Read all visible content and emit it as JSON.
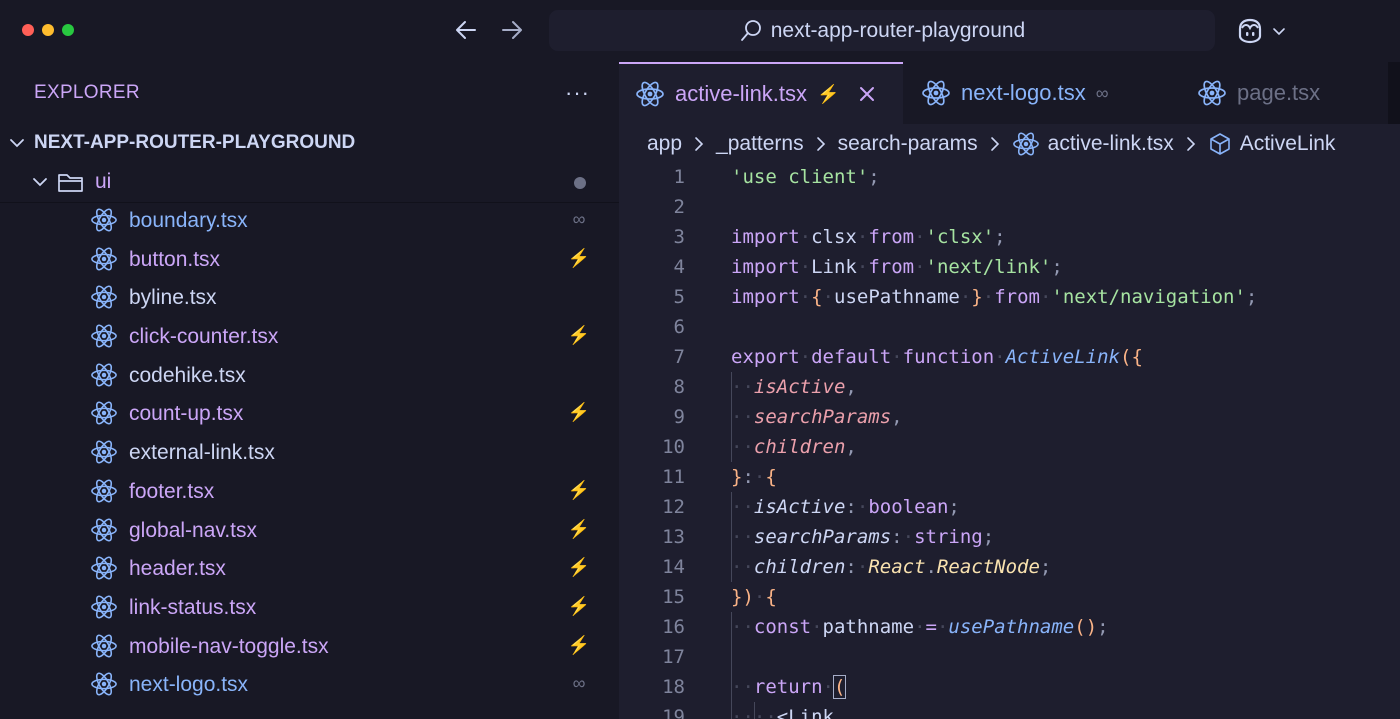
{
  "window": {
    "search_text": "next-app-router-playground"
  },
  "sidebar": {
    "header": "EXPLORER",
    "more": "···",
    "project": "NEXT-APP-ROUTER-PLAYGROUND",
    "folder": "ui",
    "files": [
      {
        "name": "boundary.tsx",
        "badge": "∞",
        "color": "#89b4fa"
      },
      {
        "name": "button.tsx",
        "badge": "⚡",
        "color": "#cba6f7"
      },
      {
        "name": "byline.tsx",
        "badge": "",
        "color": "#cdd6f4"
      },
      {
        "name": "click-counter.tsx",
        "badge": "⚡",
        "color": "#cba6f7"
      },
      {
        "name": "codehike.tsx",
        "badge": "",
        "color": "#cdd6f4"
      },
      {
        "name": "count-up.tsx",
        "badge": "⚡",
        "color": "#cba6f7"
      },
      {
        "name": "external-link.tsx",
        "badge": "",
        "color": "#cdd6f4"
      },
      {
        "name": "footer.tsx",
        "badge": "⚡",
        "color": "#cba6f7"
      },
      {
        "name": "global-nav.tsx",
        "badge": "⚡",
        "color": "#cba6f7"
      },
      {
        "name": "header.tsx",
        "badge": "⚡",
        "color": "#cba6f7"
      },
      {
        "name": "link-status.tsx",
        "badge": "⚡",
        "color": "#cba6f7"
      },
      {
        "name": "mobile-nav-toggle.tsx",
        "badge": "⚡",
        "color": "#cba6f7"
      },
      {
        "name": "next-logo.tsx",
        "badge": "∞",
        "color": "#89b4fa"
      }
    ]
  },
  "tabs": [
    {
      "label": "active-link.tsx",
      "badge": "⚡"
    },
    {
      "label": "next-logo.tsx",
      "badge": "∞"
    },
    {
      "label": "page.tsx",
      "badge": ""
    }
  ],
  "breadcrumb": [
    "app",
    "_patterns",
    "search-params",
    "active-link.tsx",
    "ActiveLink"
  ],
  "code": [
    {
      "n": "1",
      "segs": [
        [
          "'use client'",
          "str"
        ],
        [
          ";",
          "punct"
        ]
      ]
    },
    {
      "n": "2",
      "segs": []
    },
    {
      "n": "3",
      "segs": [
        [
          "import",
          "kw"
        ],
        [
          "·",
          "ws"
        ],
        [
          "clsx",
          "plain"
        ],
        [
          "·",
          "ws"
        ],
        [
          "from",
          "kw"
        ],
        [
          "·",
          "ws"
        ],
        [
          "'clsx'",
          "str"
        ],
        [
          ";",
          "punct"
        ]
      ]
    },
    {
      "n": "4",
      "segs": [
        [
          "import",
          "kw"
        ],
        [
          "·",
          "ws"
        ],
        [
          "Link",
          "plain"
        ],
        [
          "·",
          "ws"
        ],
        [
          "from",
          "kw"
        ],
        [
          "·",
          "ws"
        ],
        [
          "'next/link'",
          "str"
        ],
        [
          ";",
          "punct"
        ]
      ]
    },
    {
      "n": "5",
      "segs": [
        [
          "import",
          "kw"
        ],
        [
          "·",
          "ws"
        ],
        [
          "{",
          "brace"
        ],
        [
          "·",
          "ws"
        ],
        [
          "usePathname",
          "plain"
        ],
        [
          "·",
          "ws"
        ],
        [
          "}",
          "brace"
        ],
        [
          "·",
          "ws"
        ],
        [
          "from",
          "kw"
        ],
        [
          "·",
          "ws"
        ],
        [
          "'next/navigation'",
          "str"
        ],
        [
          ";",
          "punct"
        ]
      ]
    },
    {
      "n": "6",
      "segs": []
    },
    {
      "n": "7",
      "segs": [
        [
          "export",
          "kw"
        ],
        [
          "·",
          "ws"
        ],
        [
          "default",
          "kw"
        ],
        [
          "·",
          "ws"
        ],
        [
          "function",
          "kw"
        ],
        [
          "·",
          "ws"
        ],
        [
          "ActiveLink",
          "fn"
        ],
        [
          "(",
          "brace"
        ],
        [
          "{",
          "brace"
        ]
      ]
    },
    {
      "n": "8",
      "guide": 1,
      "segs": [
        [
          "··",
          "ws"
        ],
        [
          "isActive",
          "param"
        ],
        [
          ",",
          "punct"
        ]
      ]
    },
    {
      "n": "9",
      "guide": 1,
      "segs": [
        [
          "··",
          "ws"
        ],
        [
          "searchParams",
          "param"
        ],
        [
          ",",
          "punct"
        ]
      ]
    },
    {
      "n": "10",
      "guide": 1,
      "segs": [
        [
          "··",
          "ws"
        ],
        [
          "children",
          "param"
        ],
        [
          ",",
          "punct"
        ]
      ]
    },
    {
      "n": "11",
      "segs": [
        [
          "}",
          "brace"
        ],
        [
          ":",
          "punct"
        ],
        [
          "·",
          "ws"
        ],
        [
          "{",
          "brace"
        ]
      ]
    },
    {
      "n": "12",
      "guide": 1,
      "segs": [
        [
          "··",
          "ws"
        ],
        [
          "isActive",
          "prop"
        ],
        [
          ":",
          "punct"
        ],
        [
          "·",
          "ws"
        ],
        [
          "boolean",
          "kw"
        ],
        [
          ";",
          "punct"
        ]
      ]
    },
    {
      "n": "13",
      "guide": 1,
      "segs": [
        [
          "··",
          "ws"
        ],
        [
          "searchParams",
          "prop"
        ],
        [
          ":",
          "punct"
        ],
        [
          "·",
          "ws"
        ],
        [
          "string",
          "kw"
        ],
        [
          ";",
          "punct"
        ]
      ]
    },
    {
      "n": "14",
      "guide": 1,
      "segs": [
        [
          "··",
          "ws"
        ],
        [
          "children",
          "prop"
        ],
        [
          ":",
          "punct"
        ],
        [
          "·",
          "ws"
        ],
        [
          "React",
          "type"
        ],
        [
          ".",
          "punct"
        ],
        [
          "ReactNode",
          "type"
        ],
        [
          ";",
          "punct"
        ]
      ]
    },
    {
      "n": "15",
      "segs": [
        [
          "}",
          "brace"
        ],
        [
          ")",
          "brace"
        ],
        [
          "·",
          "ws"
        ],
        [
          "{",
          "brace"
        ]
      ]
    },
    {
      "n": "16",
      "guide": 1,
      "segs": [
        [
          "··",
          "ws"
        ],
        [
          "const",
          "kw"
        ],
        [
          "·",
          "ws"
        ],
        [
          "pathname",
          "plain"
        ],
        [
          "·",
          "ws"
        ],
        [
          "=",
          "kw"
        ],
        [
          "·",
          "ws"
        ],
        [
          "usePathname",
          "fn"
        ],
        [
          "()",
          "brace"
        ],
        [
          ";",
          "punct"
        ]
      ]
    },
    {
      "n": "17",
      "guide": 1,
      "segs": []
    },
    {
      "n": "18",
      "guide": 1,
      "segs": [
        [
          "··",
          "ws"
        ],
        [
          "return",
          "kw"
        ],
        [
          "·",
          "ws"
        ],
        [
          "(",
          "brace-box"
        ]
      ]
    },
    {
      "n": "19",
      "guide": 2,
      "segs": [
        [
          "····",
          "ws"
        ],
        [
          "<Link",
          "plain"
        ]
      ]
    }
  ]
}
